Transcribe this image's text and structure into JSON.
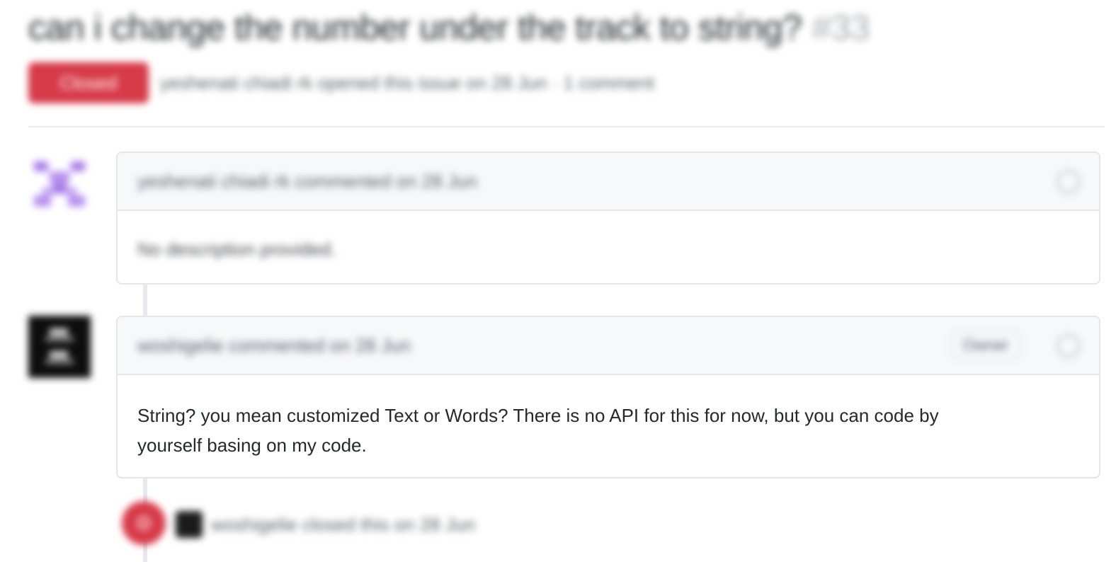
{
  "issue": {
    "title": "can i change the number under the track to string?",
    "number": "#33",
    "state_label": "Closed",
    "meta": "yeshenati chiadi rk opened this issue on 28 Jun · 1 comment"
  },
  "comments": [
    {
      "header": "yeshenati chiadi rk commented on 28 Jun",
      "body": "No description provided."
    },
    {
      "header": "woshigelie commented on 28 Jun",
      "owner_badge": "Owner",
      "body_line1": "String? you mean customized Text or Words? There is no API for this for now, but you can code by",
      "body_line2": "yourself basing on my code."
    }
  ],
  "event": {
    "text": "woshigelie closed this on 28 Jun"
  },
  "colors": {
    "closed": "#d73a49",
    "header_bg": "#f6f8fa",
    "border": "#e4e7ea"
  }
}
